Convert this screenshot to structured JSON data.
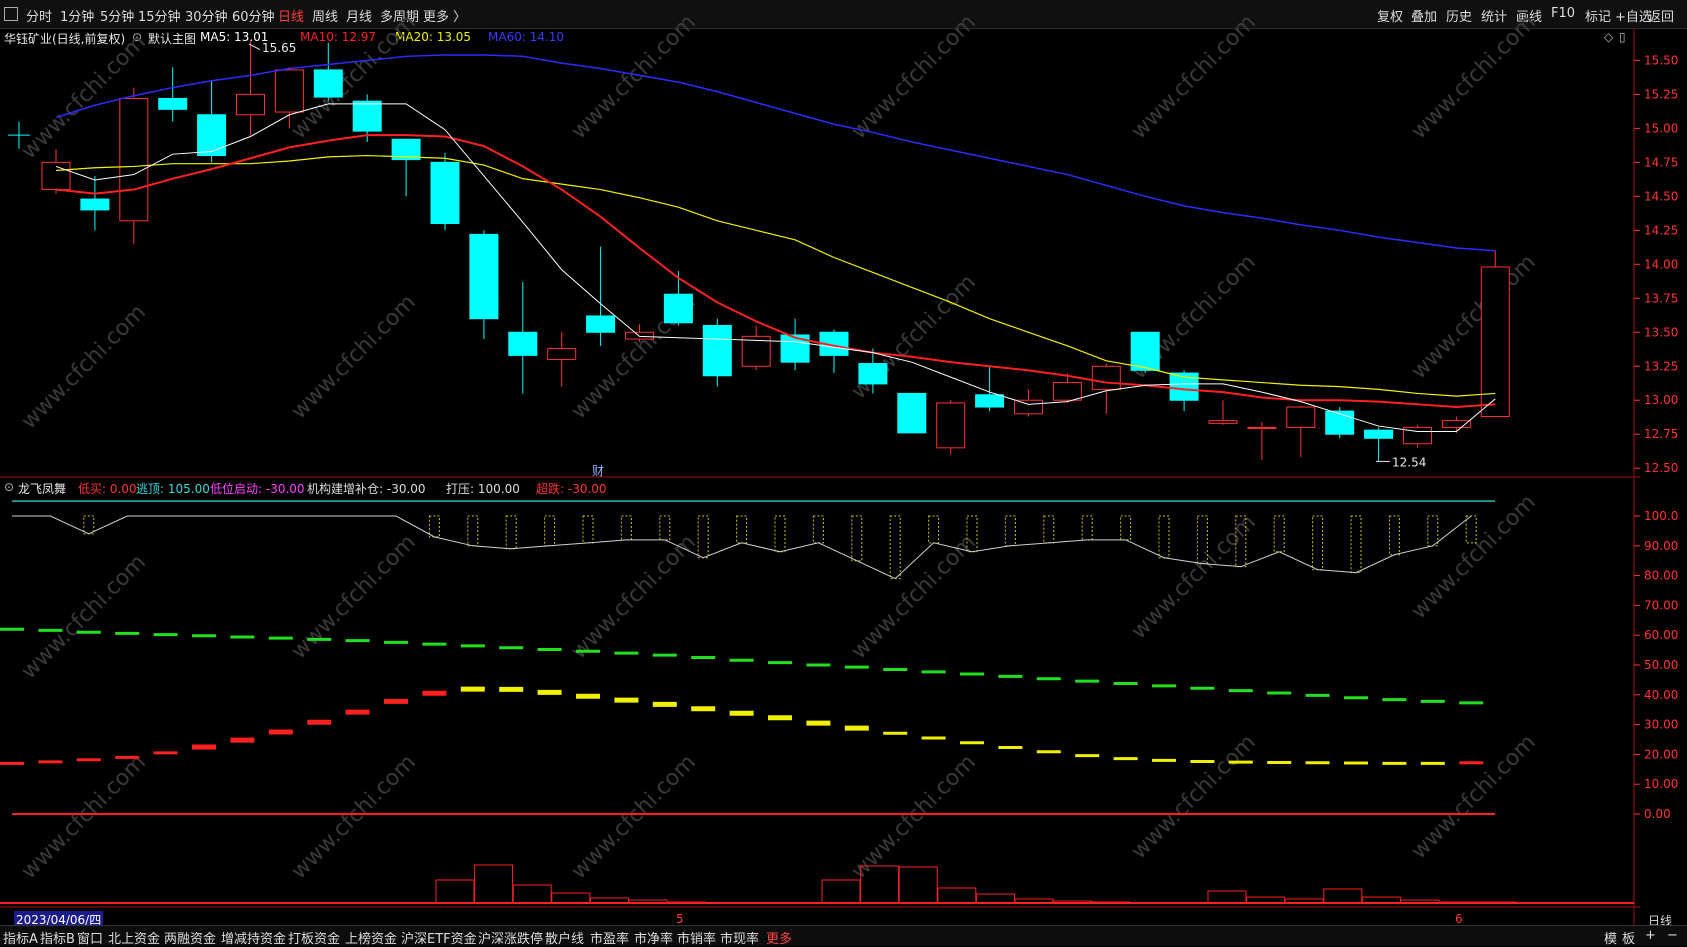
{
  "toolbar": {
    "periods": [
      "分时",
      "1分钟",
      "5分钟",
      "15分钟",
      "30分钟",
      "60分钟",
      "日线",
      "周线",
      "月线",
      "多周期",
      "更多 〉"
    ],
    "active_period": "日线",
    "right_tools": [
      "复权",
      "叠加",
      "历史",
      "统计",
      "画线",
      "F10",
      "标记",
      "+自选",
      "返回"
    ]
  },
  "main_panel": {
    "stock_title": "华钰矿业(日线,前复权)",
    "template": "默认主图",
    "ma": [
      {
        "label": "MA5: 13.01",
        "color": "#ffffff"
      },
      {
        "label": "MA10: 12.97",
        "color": "#ff2020"
      },
      {
        "label": "MA20: 13.05",
        "color": "#f0f000"
      },
      {
        "label": "MA60: 14.10",
        "color": "#3a3aff"
      }
    ],
    "high_label": "15.65",
    "low_label": "12.54",
    "fin_marker": "财"
  },
  "indicator_panel": {
    "name": "龙飞凤舞",
    "params": [
      {
        "label": "低买: 0.00",
        "color": "#ff3333"
      },
      {
        "label": "逃顶: 105.00",
        "color": "#36d8d8"
      },
      {
        "label": "低位启动: -30.00",
        "color": "#ff40ff"
      },
      {
        "label": "机构建增补仓: -30.00",
        "color": "#dddddd"
      },
      {
        "label": "打压: 100.00",
        "color": "#dddddd"
      },
      {
        "label": "超跌: -30.00",
        "color": "#ff3333"
      }
    ]
  },
  "price_axis": [
    "15.50",
    "15.25",
    "15.00",
    "14.75",
    "14.50",
    "14.25",
    "14.00",
    "13.75",
    "13.50",
    "13.25",
    "13.00",
    "12.75",
    "12.50"
  ],
  "ind_axis": [
    "100.0",
    "90.00",
    "80.00",
    "70.00",
    "60.00",
    "50.00",
    "40.00",
    "30.00",
    "20.00",
    "10.00",
    "0.00"
  ],
  "date_axis": {
    "current": "2023/04/06/四",
    "m1": "5",
    "m2": "6",
    "period_label": "日线"
  },
  "bottom_tabs": [
    "指标A",
    "指标B",
    "窗口",
    "北上资金",
    "两融资金",
    "增减持资金",
    "打板资金",
    "上榜资金",
    "沪深ETF资金",
    "沪深涨跌停",
    "散户线",
    "市盈率",
    "市净率",
    "市销率",
    "市现率",
    "更多"
  ],
  "bottom_right": [
    "模",
    "板",
    "+",
    "−"
  ],
  "watermark": "www.cfchi.com",
  "colors": {
    "up": "#ff3030",
    "down": "#00ffff",
    "ma5": "#ffffff",
    "ma10": "#ff2020",
    "ma20": "#f0f000",
    "ma60": "#2c2cff",
    "grid": "#7a1010"
  },
  "chart_data": {
    "type": "candlestick",
    "title": "华钰矿业(日线,前复权)",
    "ylim": [
      12.45,
      15.65
    ],
    "candles": [
      {
        "o": 14.55,
        "c": 14.75,
        "h": 14.85,
        "l": 14.52
      },
      {
        "o": 14.48,
        "c": 14.4,
        "h": 14.65,
        "l": 14.25
      },
      {
        "o": 14.32,
        "c": 15.22,
        "h": 15.3,
        "l": 14.15
      },
      {
        "o": 15.22,
        "c": 15.14,
        "h": 15.45,
        "l": 15.05
      },
      {
        "o": 15.1,
        "c": 14.8,
        "h": 15.35,
        "l": 14.75
      },
      {
        "o": 15.1,
        "c": 15.25,
        "h": 15.65,
        "l": 14.95
      },
      {
        "o": 15.12,
        "c": 15.43,
        "h": 15.45,
        "l": 15.0
      },
      {
        "o": 15.43,
        "c": 15.23,
        "h": 15.63,
        "l": 15.2
      },
      {
        "o": 15.2,
        "c": 14.98,
        "h": 15.25,
        "l": 14.9
      },
      {
        "o": 14.92,
        "c": 14.77,
        "h": 14.9,
        "l": 14.5
      },
      {
        "o": 14.75,
        "c": 14.3,
        "h": 14.82,
        "l": 14.25
      },
      {
        "o": 14.22,
        "c": 13.6,
        "h": 14.25,
        "l": 13.45
      },
      {
        "o": 13.5,
        "c": 13.33,
        "h": 13.87,
        "l": 13.05
      },
      {
        "o": 13.3,
        "c": 13.38,
        "h": 13.5,
        "l": 13.1
      },
      {
        "o": 13.62,
        "c": 13.5,
        "h": 14.13,
        "l": 13.4
      },
      {
        "o": 13.45,
        "c": 13.5,
        "h": 13.56,
        "l": 13.43
      },
      {
        "o": 13.78,
        "c": 13.57,
        "h": 13.95,
        "l": 13.55
      },
      {
        "o": 13.55,
        "c": 13.18,
        "h": 13.6,
        "l": 13.1
      },
      {
        "o": 13.25,
        "c": 13.47,
        "h": 13.55,
        "l": 13.22
      },
      {
        "o": 13.48,
        "c": 13.28,
        "h": 13.6,
        "l": 13.22
      },
      {
        "o": 13.5,
        "c": 13.33,
        "h": 13.52,
        "l": 13.2
      },
      {
        "o": 13.27,
        "c": 13.12,
        "h": 13.38,
        "l": 13.05
      },
      {
        "o": 13.05,
        "c": 12.76,
        "h": 13.05,
        "l": 12.76
      },
      {
        "o": 12.65,
        "c": 12.98,
        "h": 13.0,
        "l": 12.6
      },
      {
        "o": 13.04,
        "c": 12.95,
        "h": 13.25,
        "l": 12.92
      },
      {
        "o": 12.9,
        "c": 13.0,
        "h": 13.08,
        "l": 12.88
      },
      {
        "o": 13.0,
        "c": 13.13,
        "h": 13.2,
        "l": 12.98
      },
      {
        "o": 13.08,
        "c": 13.25,
        "h": 13.27,
        "l": 12.9
      },
      {
        "o": 13.5,
        "c": 13.22,
        "h": 13.5,
        "l": 13.2
      },
      {
        "o": 13.2,
        "c": 13.0,
        "h": 13.22,
        "l": 12.92
      },
      {
        "o": 12.83,
        "c": 12.85,
        "h": 13.0,
        "l": 12.82
      },
      {
        "o": 12.8,
        "c": 12.8,
        "h": 12.84,
        "l": 12.56
      },
      {
        "o": 12.8,
        "c": 12.95,
        "h": 12.96,
        "l": 12.58
      },
      {
        "o": 12.92,
        "c": 12.75,
        "h": 12.95,
        "l": 12.72
      },
      {
        "o": 12.78,
        "c": 12.72,
        "h": 12.8,
        "l": 12.55
      },
      {
        "o": 12.68,
        "c": 12.8,
        "h": 12.82,
        "l": 12.65
      },
      {
        "o": 12.8,
        "c": 12.85,
        "h": 12.88,
        "l": 12.76
      },
      {
        "o": 12.88,
        "c": 13.98,
        "h": 14.1,
        "l": 12.88
      }
    ],
    "ma5": [
      14.72,
      14.62,
      14.66,
      14.81,
      14.83,
      14.94,
      15.1,
      15.18,
      15.18,
      15.18,
      14.99,
      14.65,
      14.31,
      13.96,
      13.71,
      13.47,
      13.46,
      13.45,
      13.44,
      13.43,
      13.39,
      13.35,
      13.28,
      13.17,
      13.06,
      12.97,
      12.99,
      13.07,
      13.11,
      13.12,
      13.12,
      13.06,
      12.99,
      12.9,
      12.81,
      12.77,
      12.77,
      13.01
    ],
    "ma10": [
      14.55,
      14.52,
      14.55,
      14.63,
      14.7,
      14.78,
      14.86,
      14.91,
      14.95,
      14.95,
      14.94,
      14.87,
      14.72,
      14.55,
      14.35,
      14.12,
      13.9,
      13.72,
      13.58,
      13.46,
      13.4,
      13.35,
      13.32,
      13.28,
      13.25,
      13.22,
      13.18,
      13.13,
      13.11,
      13.08,
      13.06,
      13.02,
      13.0,
      13.0,
      12.99,
      12.97,
      12.95,
      12.97
    ],
    "ma20": [
      14.69,
      14.71,
      14.72,
      14.74,
      14.74,
      14.74,
      14.76,
      14.79,
      14.8,
      14.79,
      14.78,
      14.73,
      14.63,
      14.59,
      14.55,
      14.49,
      14.42,
      14.32,
      14.25,
      14.18,
      14.05,
      13.94,
      13.83,
      13.72,
      13.6,
      13.5,
      13.4,
      13.29,
      13.24,
      13.17,
      13.15,
      13.13,
      13.11,
      13.1,
      13.08,
      13.05,
      13.03,
      13.05
    ],
    "ma60": [
      15.08,
      15.17,
      15.24,
      15.3,
      15.35,
      15.39,
      15.44,
      15.47,
      15.5,
      15.53,
      15.54,
      15.54,
      15.53,
      15.48,
      15.44,
      15.39,
      15.34,
      15.27,
      15.19,
      15.11,
      15.03,
      14.97,
      14.9,
      14.84,
      14.78,
      14.72,
      14.66,
      14.58,
      14.5,
      14.43,
      14.38,
      14.34,
      14.29,
      14.25,
      14.2,
      14.16,
      14.12,
      14.1
    ]
  }
}
